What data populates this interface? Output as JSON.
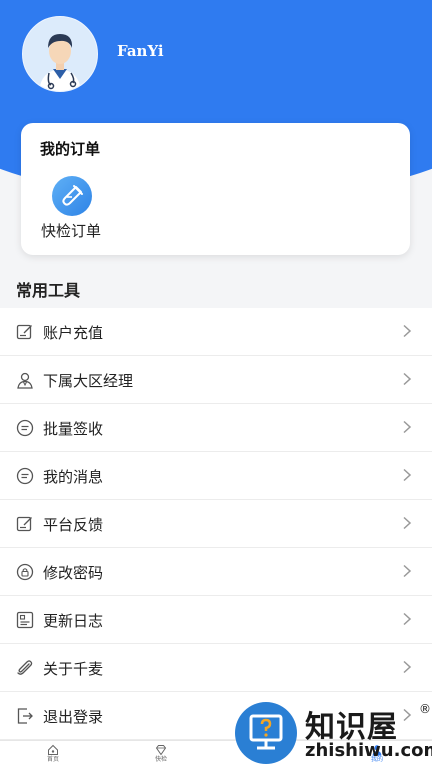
{
  "profile": {
    "username": "FanYi"
  },
  "orders": {
    "title": "我的订单",
    "quick_check_label": "快检订单"
  },
  "tools": {
    "title": "常用工具",
    "items": [
      {
        "label": "账户充值",
        "icon": "edit-icon"
      },
      {
        "label": "下属大区经理",
        "icon": "user-icon"
      },
      {
        "label": "批量签收",
        "icon": "message-icon"
      },
      {
        "label": "我的消息",
        "icon": "message-icon"
      },
      {
        "label": "平台反馈",
        "icon": "edit-icon"
      },
      {
        "label": "修改密码",
        "icon": "lock-icon"
      },
      {
        "label": "更新日志",
        "icon": "log-icon"
      },
      {
        "label": "关于千麦",
        "icon": "paperclip-icon"
      },
      {
        "label": "退出登录",
        "icon": "logout-icon"
      }
    ]
  },
  "tabbar": {
    "items": [
      {
        "label": "首页",
        "icon": "home-icon"
      },
      {
        "label": "快检",
        "icon": "diamond-icon"
      },
      {
        "label": "",
        "icon": "tab-icon"
      },
      {
        "label": "我的",
        "icon": "profile-icon"
      }
    ],
    "active_index": 3
  },
  "watermark": {
    "text": "知识屋",
    "reg": "®",
    "url": "zhishiwu.com"
  },
  "colors": {
    "primary": "#2f7bf0",
    "background": "#f4f5f7"
  }
}
